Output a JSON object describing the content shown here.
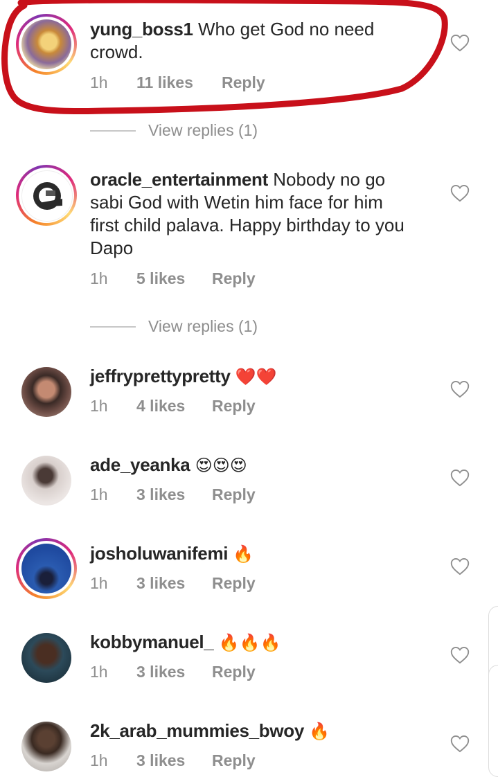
{
  "comments": [
    {
      "username": "yung_boss1",
      "text": "Who get God no need crowd.",
      "line1": " Who get God no need",
      "line2": "crowd.",
      "time": "1h",
      "likes": "11 likes",
      "reply": "Reply",
      "view_replies": "View replies (1)",
      "highlighted": true
    },
    {
      "username": "oracle_entertainment",
      "line1": " Nobody no go",
      "line2": "sabi God with Wetin him face for him",
      "line3": "first child palava. Happy birthday to you",
      "line4": "Dapo",
      "time": "1h",
      "likes": "5 likes",
      "reply": "Reply",
      "view_replies": "View replies (1)"
    },
    {
      "username": "jeffryprettypretty",
      "emoji": "❤️❤️",
      "time": "1h",
      "likes": "4 likes",
      "reply": "Reply"
    },
    {
      "username": "ade_yeanka",
      "emoji": "😍😍😍",
      "time": "1h",
      "likes": "3 likes",
      "reply": "Reply"
    },
    {
      "username": "josholuwanifemi",
      "emoji": "🔥",
      "time": "1h",
      "likes": "3 likes",
      "reply": "Reply"
    },
    {
      "username": "kobbymanuel_",
      "emoji": "🔥🔥🔥",
      "time": "1h",
      "likes": "3 likes",
      "reply": "Reply"
    },
    {
      "username": "2k_arab_mummies_bwoy",
      "emoji": "🔥",
      "time": "1h",
      "likes": "3 likes",
      "reply": "Reply"
    }
  ],
  "icons": {
    "like": "heart-outline-icon"
  },
  "colors": {
    "highlight_stroke": "#c8101a",
    "secondary_text": "#8e8e8e",
    "heart_red": "#e0242b",
    "fire": "#f4900c"
  }
}
